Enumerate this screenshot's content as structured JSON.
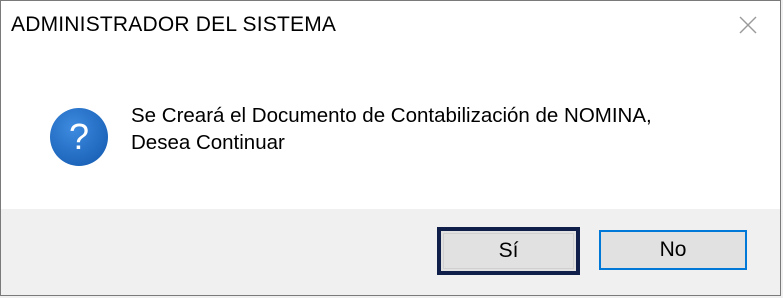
{
  "dialog": {
    "title": "ADMINISTRADOR DEL SISTEMA",
    "message_lines": [
      "Se Creará el Documento de Contabilización de NOMINA,",
      "Desea Continuar"
    ],
    "icon": "question-icon",
    "buttons": {
      "yes_label": "Sí",
      "no_label": "No"
    }
  },
  "colors": {
    "icon_blue": "#1f6fc5",
    "highlight_border": "#0f1f4a",
    "focus_border": "#0078d7"
  }
}
